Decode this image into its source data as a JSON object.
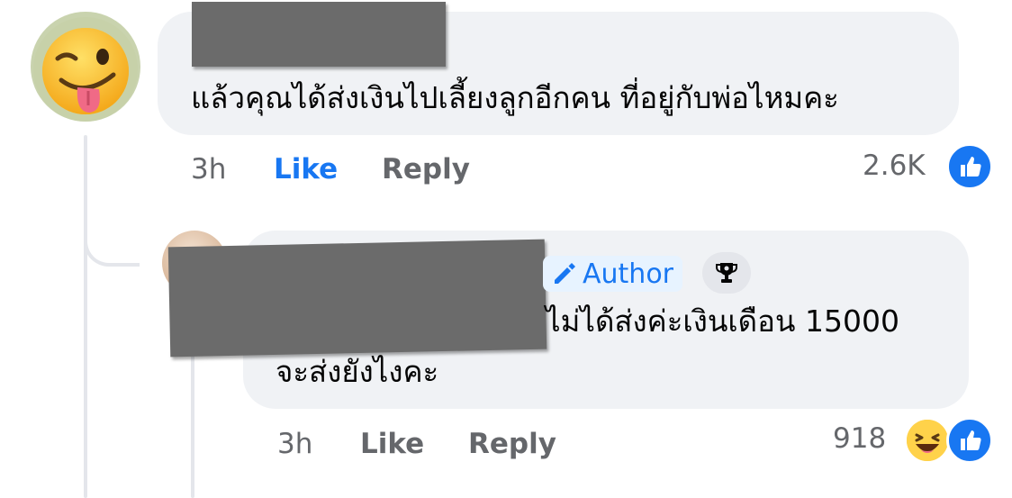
{
  "colors": {
    "accent": "#1877f2",
    "bubble": "#f0f2f5",
    "muted_text": "#65676b",
    "thread_line": "#e4e6eb",
    "redaction": "#6b6b6b"
  },
  "comment": {
    "text": "แล้วคุณได้ส่งเงินไปเลี้ยงลูกอีกคน ที่อยู่กับพ่อไหมคะ",
    "time": "3h",
    "like_label": "Like",
    "reply_label": "Reply",
    "reaction_count": "2.6K",
    "reaction_icons": [
      "like-icon"
    ],
    "avatar_icon": "winking-tongue-face"
  },
  "reply": {
    "badge_author": "Author",
    "badge_icon": "pencil-icon",
    "top_fan_icon": "trophy-icon",
    "text_line1": "ไม่ได้ส่งค่ะเงินเดือน 15000",
    "text_line2": "จะส่งยังไงคะ",
    "time": "3h",
    "like_label": "Like",
    "reply_label": "Reply",
    "reaction_count": "918",
    "reaction_icons": [
      "haha-icon",
      "like-icon"
    ]
  }
}
